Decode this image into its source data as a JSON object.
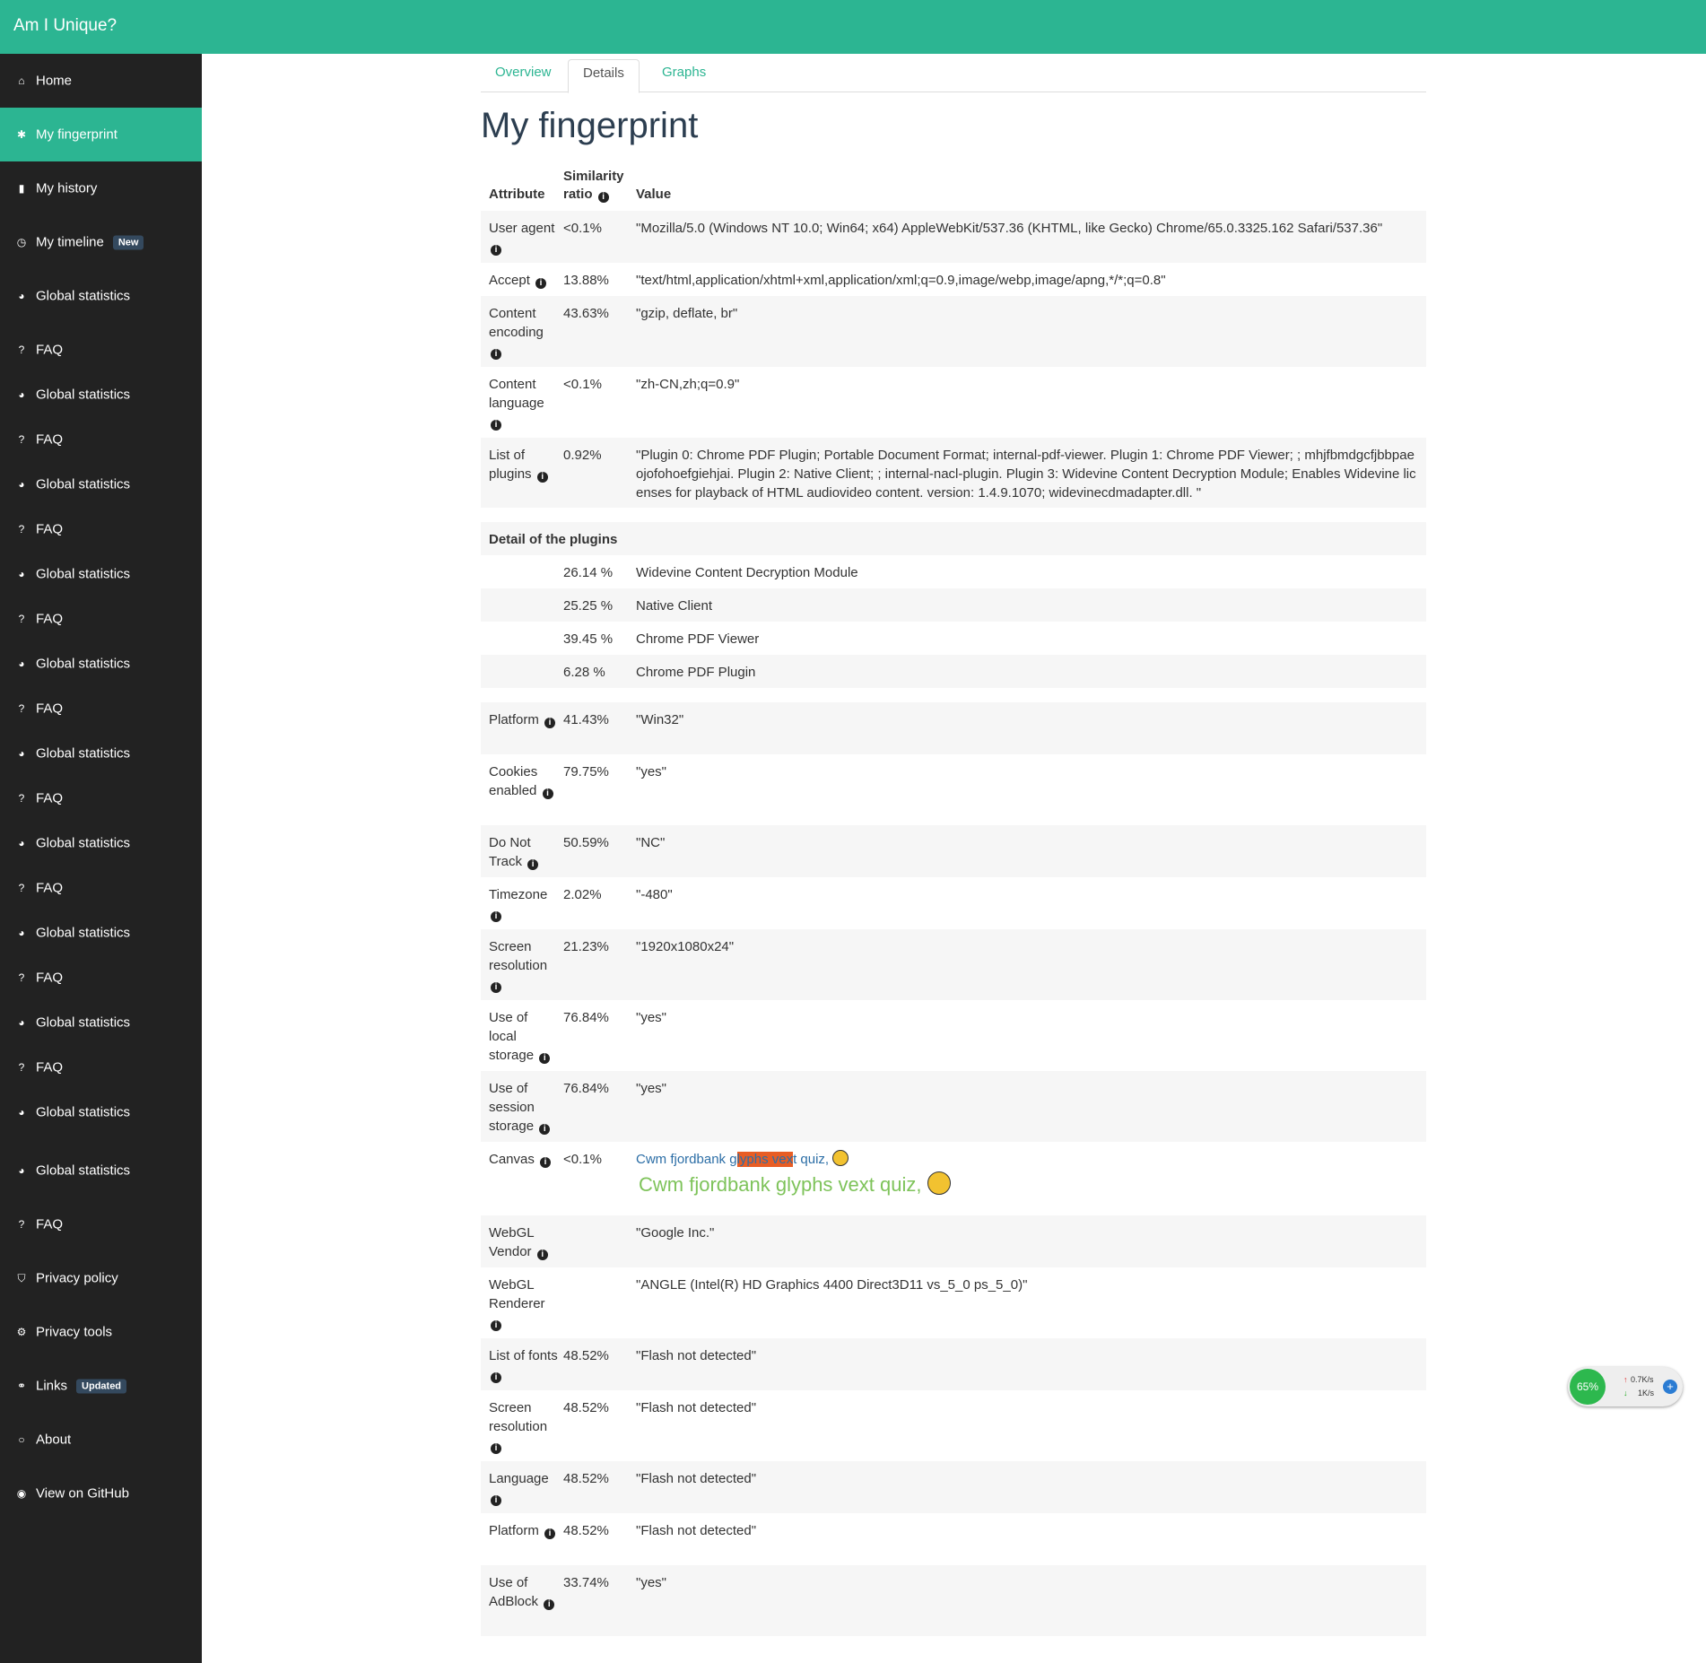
{
  "app": {
    "title": "Am I Unique?"
  },
  "sidebar": {
    "items": [
      {
        "label": "Home",
        "icon": "home-icon",
        "glyph": "⌂",
        "active": false,
        "badge": ""
      },
      {
        "label": "My fingerprint",
        "icon": "paw-icon",
        "glyph": "✱",
        "active": true,
        "badge": ""
      },
      {
        "label": "My history",
        "icon": "book-icon",
        "glyph": "▮",
        "active": false,
        "badge": ""
      },
      {
        "label": "My timeline",
        "icon": "clock-icon",
        "glyph": "◷",
        "active": false,
        "badge": "New"
      },
      {
        "label": "Global statistics",
        "icon": "pie-chart-icon",
        "glyph": "◕",
        "active": false,
        "badge": ""
      },
      {
        "label": "FAQ",
        "icon": "question-icon",
        "glyph": "?",
        "active": false,
        "badge": ""
      },
      {
        "label": "Global statistics",
        "icon": "pie-chart-icon",
        "glyph": "◕",
        "active": false,
        "badge": ""
      },
      {
        "label": "FAQ",
        "icon": "question-icon",
        "glyph": "?",
        "active": false,
        "badge": ""
      },
      {
        "label": "Global statistics",
        "icon": "pie-chart-icon",
        "glyph": "◕",
        "active": false,
        "badge": ""
      },
      {
        "label": "FAQ",
        "icon": "question-icon",
        "glyph": "?",
        "active": false,
        "badge": ""
      },
      {
        "label": "Global statistics",
        "icon": "pie-chart-icon",
        "glyph": "◕",
        "active": false,
        "badge": ""
      },
      {
        "label": "FAQ",
        "icon": "question-icon",
        "glyph": "?",
        "active": false,
        "badge": ""
      },
      {
        "label": "Global statistics",
        "icon": "pie-chart-icon",
        "glyph": "◕",
        "active": false,
        "badge": ""
      },
      {
        "label": "FAQ",
        "icon": "question-icon",
        "glyph": "?",
        "active": false,
        "badge": ""
      },
      {
        "label": "Global statistics",
        "icon": "pie-chart-icon",
        "glyph": "◕",
        "active": false,
        "badge": ""
      },
      {
        "label": "FAQ",
        "icon": "question-icon",
        "glyph": "?",
        "active": false,
        "badge": ""
      },
      {
        "label": "Global statistics",
        "icon": "pie-chart-icon",
        "glyph": "◕",
        "active": false,
        "badge": ""
      },
      {
        "label": "FAQ",
        "icon": "question-icon",
        "glyph": "?",
        "active": false,
        "badge": ""
      },
      {
        "label": "Global statistics",
        "icon": "pie-chart-icon",
        "glyph": "◕",
        "active": false,
        "badge": ""
      },
      {
        "label": "FAQ",
        "icon": "question-icon",
        "glyph": "?",
        "active": false,
        "badge": ""
      },
      {
        "label": "Global statistics",
        "icon": "pie-chart-icon",
        "glyph": "◕",
        "active": false,
        "badge": ""
      },
      {
        "label": "FAQ",
        "icon": "question-icon",
        "glyph": "?",
        "active": false,
        "badge": ""
      },
      {
        "label": "Global statistics",
        "icon": "pie-chart-icon",
        "glyph": "◕",
        "active": false,
        "badge": ""
      },
      {
        "label": "Global statistics",
        "icon": "pie-chart-icon",
        "glyph": "◕",
        "active": false,
        "badge": ""
      },
      {
        "label": "FAQ",
        "icon": "question-icon",
        "glyph": "?",
        "active": false,
        "badge": ""
      },
      {
        "label": "Privacy policy",
        "icon": "shield-icon",
        "glyph": "⛉",
        "active": false,
        "badge": ""
      },
      {
        "label": "Privacy tools",
        "icon": "gears-icon",
        "glyph": "⚙",
        "active": false,
        "badge": ""
      },
      {
        "label": "Links",
        "icon": "link-icon",
        "glyph": "⚭",
        "active": false,
        "badge": "Updated"
      },
      {
        "label": "About",
        "icon": "circle-icon",
        "glyph": "○",
        "active": false,
        "badge": ""
      },
      {
        "label": "View on GitHub",
        "icon": "github-icon",
        "glyph": "◉",
        "active": false,
        "badge": ""
      }
    ]
  },
  "tabs": [
    {
      "label": "Overview",
      "active": false
    },
    {
      "label": "Details",
      "active": true
    },
    {
      "label": "Graphs",
      "active": false
    }
  ],
  "page": {
    "title": "My fingerprint"
  },
  "table": {
    "headers": {
      "attribute": "Attribute",
      "ratio_line1": "Similarity",
      "ratio_line2": "ratio",
      "value": "Value"
    },
    "rows": [
      {
        "attr": "User agent",
        "ratio": "<0.1%",
        "value": "\"Mozilla/5.0 (Windows NT 10.0; Win64; x64) AppleWebKit/537.36 (KHTML, like Gecko) Chrome/65.0.3325.162 Safari/537.36\""
      },
      {
        "attr": "Accept",
        "ratio": "13.88%",
        "value": "\"text/html,application/xhtml+xml,application/xml;q=0.9,image/webp,image/apng,*/*;q=0.8\""
      },
      {
        "attr": "Content encoding",
        "ratio": "43.63%",
        "value": "\"gzip, deflate, br\""
      },
      {
        "attr": "Content language",
        "ratio": "<0.1%",
        "value": "\"zh-CN,zh;q=0.9\""
      },
      {
        "attr": "List of plugins",
        "ratio": "0.92%",
        "value": "\"Plugin 0: Chrome PDF Plugin; Portable Document Format; internal-pdf-viewer. Plugin 1: Chrome PDF Viewer; ; mhjfbmdgcfjbbpaeojofohoefgiehjai. Plugin 2: Native Client; ; internal-nacl-plugin. Plugin 3: Widevine Content Decryption Module; Enables Widevine licenses for playback of HTML audiovideo content. version: 1.4.9.1070; widevinecdmadapter.dll. \""
      },
      {
        "section": "Detail of the plugins"
      },
      {
        "attr": "",
        "ratio": "26.14 %",
        "value": "Widevine Content Decryption Module",
        "sub": true
      },
      {
        "attr": "",
        "ratio": "25.25 %",
        "value": "Native Client",
        "sub": true
      },
      {
        "attr": "",
        "ratio": "39.45 %",
        "value": "Chrome PDF Viewer",
        "sub": true
      },
      {
        "attr": "",
        "ratio": "6.28 %",
        "value": "Chrome PDF Plugin",
        "sub": true
      },
      {
        "attr": "Platform",
        "ratio": "41.43%",
        "value": "\"Win32\""
      },
      {
        "attr": "Cookies enabled",
        "ratio": "79.75%",
        "value": "\"yes\""
      },
      {
        "attr": "Do Not Track",
        "ratio": "50.59%",
        "value": "\"NC\""
      },
      {
        "attr": "Timezone",
        "ratio": "2.02%",
        "value": "\"-480\""
      },
      {
        "attr": "Screen resolution",
        "ratio": "21.23%",
        "value": "\"1920x1080x24\""
      },
      {
        "attr": "Use of local storage",
        "ratio": "76.84%",
        "value": "\"yes\""
      },
      {
        "attr": "Use of session storage",
        "ratio": "76.84%",
        "value": "\"yes\""
      },
      {
        "attr": "Canvas",
        "ratio": "<0.1%",
        "canvas": true,
        "canvas_pre": "Cwm fjordbank g",
        "canvas_hl": "lyphs vex",
        "canvas_post": "t quiz, ",
        "canvas_line2": "Cwm fjordbank glyphs vext quiz, "
      },
      {
        "attr": "WebGL Vendor",
        "ratio": "",
        "value": "\"Google Inc.\""
      },
      {
        "attr": "WebGL Renderer",
        "ratio": "",
        "value": "\"ANGLE (Intel(R) HD Graphics 4400 Direct3D11 vs_5_0 ps_5_0)\""
      },
      {
        "attr": "List of fonts",
        "ratio": "48.52%",
        "value": "\"Flash not detected\""
      },
      {
        "attr": "Screen resolution",
        "ratio": "48.52%",
        "value": "\"Flash not detected\""
      },
      {
        "attr": "Language",
        "ratio": "48.52%",
        "value": "\"Flash not detected\""
      },
      {
        "attr": "Platform",
        "ratio": "48.52%",
        "value": "\"Flash not detected\""
      },
      {
        "attr": "Use of AdBlock",
        "ratio": "33.74%",
        "value": "\"yes\""
      }
    ]
  },
  "widget": {
    "percent": "65%",
    "up": "0.7K/s",
    "down": "1K/s"
  },
  "colors": {
    "accent": "#2cb592",
    "sidebar": "#222222",
    "canvas_text": "#2c6ea6",
    "canvas_green": "#7ec35a",
    "canvas_highlight": "#e85d24"
  }
}
